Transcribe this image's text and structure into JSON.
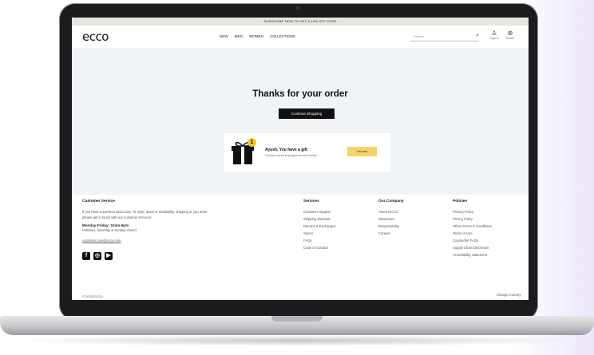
{
  "promo": {
    "text": "SUBSCRIBE NOW TO GET A 10% OFF CODE"
  },
  "header": {
    "logo": "ecco",
    "nav": [
      "NEW",
      "MEN",
      "WOMEN",
      "COLLECTIONS"
    ],
    "search_placeholder": "Search",
    "signin_label": "Sign in",
    "stores_label": "Stores"
  },
  "main": {
    "title": "Thanks for your order",
    "continue_label": "Continue Shopping",
    "gift": {
      "badge": "1",
      "title": "Ayush, You have a gift",
      "subtitle": "Choose a free keyring from our friends",
      "button": "choose"
    }
  },
  "footer": {
    "customer_service": {
      "heading": "Customer Service",
      "text": "If you have a question about size, fit, style, stock or availability, shipping or you order, please get in touch with our customer services:",
      "hours": "Monday-Friday: 10am-6pm",
      "closed": "Holidays, Saturday & Sunday closed",
      "email": "customer.care@ecco.com"
    },
    "services": {
      "heading": "Services",
      "items": [
        "Customer Support",
        "Shipping Methods",
        "Returns & Exchanges",
        "Stores",
        "FAQs",
        "Code of Conduct"
      ]
    },
    "company": {
      "heading": "Our Company",
      "items": [
        "About ECCO",
        "Newsroom",
        "Responsibility",
        "Careers"
      ]
    },
    "policies": {
      "heading": "Policies",
      "items": [
        "Privacy Policy",
        "Pricing Policy",
        "Offers Terms & Conditions",
        "Terms of Use",
        "Counterfeit FAQs",
        "Supply Chain Disclosure",
        "Accessibility Statement"
      ]
    },
    "copyright": "© 2023 ECCO",
    "country": "Change Country"
  }
}
